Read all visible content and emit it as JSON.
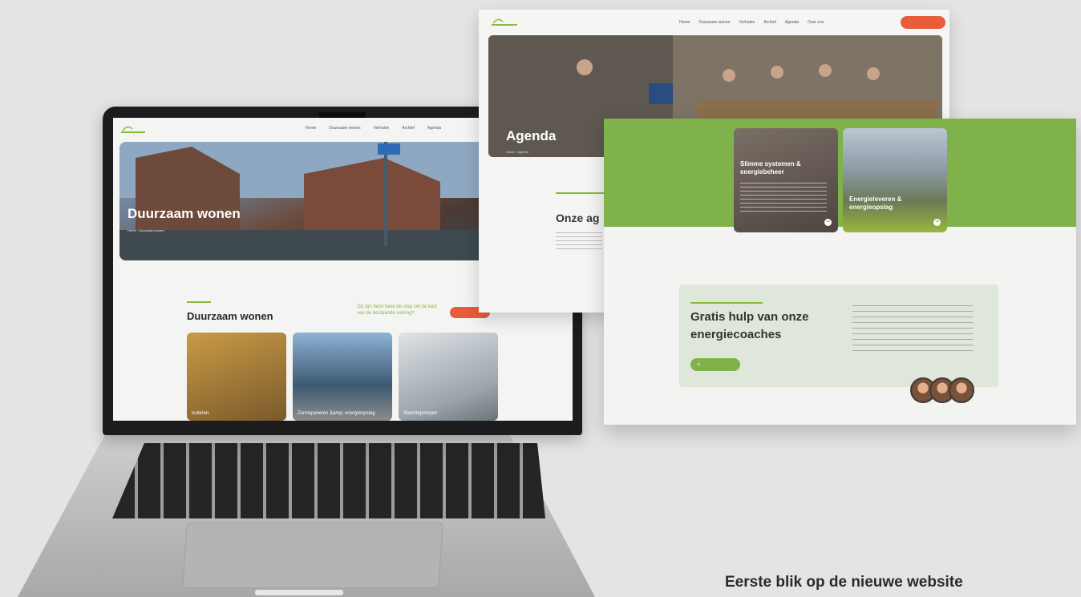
{
  "laptop": {
    "nav": [
      "Home",
      "Duurzaam wonen",
      "Verhalen",
      "Archief",
      "Agenda"
    ],
    "hero_title": "Duurzaam wonen",
    "section_title": "Duurzaam wonen",
    "quote": "Op zijn deze twee de stap zet de kast van de bestaande woning?",
    "cards": [
      "Isoleren",
      "Zonnepanelen &amp; energieopslag",
      "Warmtepompen"
    ]
  },
  "agenda_page": {
    "nav": [
      "Home",
      "Duurzaam wonen",
      "Verhalen",
      "Archief",
      "Agenda",
      "Over ons"
    ],
    "hero_title": "Agenda",
    "section_title": "Onze ag"
  },
  "third_page": {
    "cards": [
      {
        "title": "Slimme systemen & energiebeheer"
      },
      {
        "title": "Energieleveren & energieopslag"
      }
    ],
    "help_title": "Gratis hulp van onze energiecoaches"
  },
  "caption": "Eerste blik op de nieuwe website",
  "colors": {
    "brand_green": "#7fb24b",
    "accent_orange": "#e85d3a",
    "background": "#e4e4e3"
  }
}
